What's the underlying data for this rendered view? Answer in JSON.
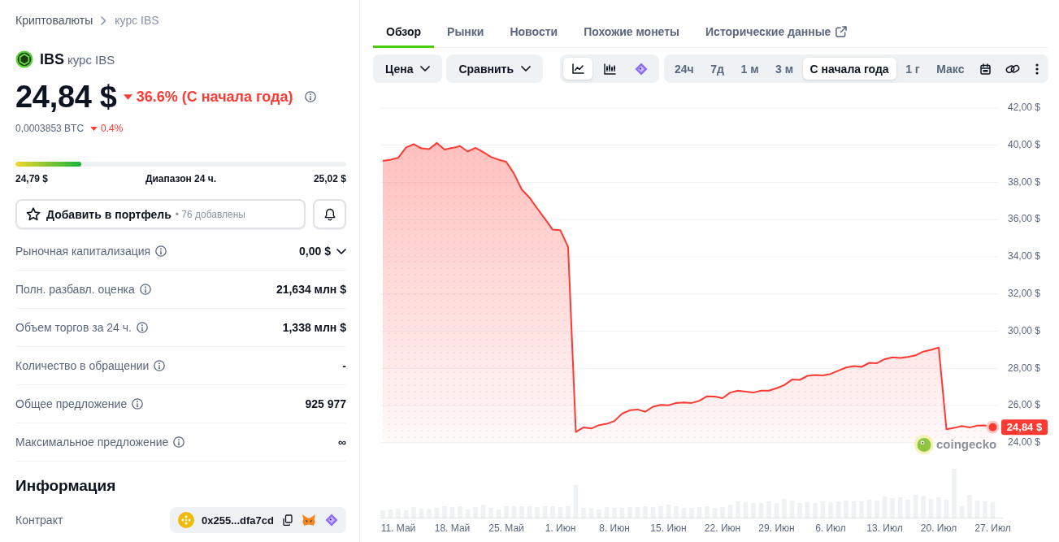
{
  "breadcrumb": [
    {
      "label": "Криптовалюты",
      "current": false
    },
    {
      "label": "курс IBS",
      "current": true
    }
  ],
  "coin": {
    "symbol": "IBS",
    "name": "курс IBS",
    "price": "24,84 $",
    "change": {
      "down": true,
      "text": "36.6% (С начала года)"
    },
    "btc_price": "0,0003853 BTC",
    "btc_change": {
      "down": true,
      "text": "0.4%"
    }
  },
  "range_24h": {
    "level": 0.2,
    "low": "24,79 $",
    "label": "Диапазон 24 ч.",
    "high": "25,02 $"
  },
  "portfolio_button": {
    "label": "Добавить в портфель",
    "count": "• 76 добавлены"
  },
  "stats": [
    {
      "label": "Рыночная капитализация",
      "value": "0,00 $",
      "expandable": true
    },
    {
      "label": "Полн. разбавл. оценка",
      "value": "21,634 млн $",
      "expandable": false
    },
    {
      "label": "Объем торгов за 24 ч.",
      "value": "1,338 млн $",
      "expandable": false
    },
    {
      "label": "Количество в обращении",
      "value": "-",
      "expandable": false
    },
    {
      "label": "Общее предложение",
      "value": "925 977",
      "expandable": false
    },
    {
      "label": "Максимальное предложение",
      "value": "∞",
      "expandable": false
    }
  ],
  "info": {
    "title": "Информация",
    "rows": [
      {
        "label": "Контракт",
        "address": "0x255...dfa7cd"
      }
    ]
  },
  "tabs": [
    {
      "label": "Обзор",
      "selected": true,
      "external": false
    },
    {
      "label": "Рынки",
      "selected": false,
      "external": false
    },
    {
      "label": "Новости",
      "selected": false,
      "external": false
    },
    {
      "label": "Похожие монеты",
      "selected": false,
      "external": false
    },
    {
      "label": "Исторические данные",
      "selected": false,
      "external": true
    }
  ],
  "toolbar": {
    "dropdowns": [
      {
        "label": "Цена"
      },
      {
        "label": "Сравнить"
      }
    ],
    "chart_types": [
      {
        "kind": "line",
        "selected": true
      },
      {
        "kind": "candles",
        "selected": false
      },
      {
        "kind": "diamond",
        "selected": false
      }
    ],
    "ranges": [
      {
        "label": "24ч",
        "selected": false
      },
      {
        "label": "7д",
        "selected": false
      },
      {
        "label": "1 м",
        "selected": false
      },
      {
        "label": "3 м",
        "selected": false
      },
      {
        "label": "С начала года",
        "selected": true
      },
      {
        "label": "1 г",
        "selected": false
      },
      {
        "label": "Макс",
        "selected": false
      }
    ],
    "tools": [
      {
        "kind": "calendar"
      },
      {
        "kind": "link"
      },
      {
        "kind": "more"
      }
    ]
  },
  "chart": {
    "brand": "coingecko",
    "chart_data": {
      "type": "area",
      "grid": true,
      "categories": [
        null,
        null,
        "11. Май",
        null,
        null,
        null,
        null,
        null,
        null,
        "18. Май",
        null,
        null,
        null,
        null,
        null,
        null,
        "25. Май",
        null,
        null,
        null,
        null,
        null,
        null,
        "1. Июн",
        null,
        null,
        null,
        null,
        null,
        null,
        "8. Июн",
        null,
        null,
        null,
        null,
        null,
        null,
        "15. Июн",
        null,
        null,
        null,
        null,
        null,
        null,
        "22. Июн",
        null,
        null,
        null,
        null,
        null,
        null,
        "29. Июн",
        null,
        null,
        null,
        null,
        null,
        null,
        "6. Июл",
        null,
        null,
        null,
        null,
        null,
        null,
        "13. Июл",
        null,
        null,
        null,
        null,
        null,
        null,
        "20. Июл",
        null,
        null,
        null,
        null,
        null,
        null,
        "27. Июл"
      ],
      "values": [
        39.15,
        39.22,
        39.32,
        39.87,
        40.06,
        39.83,
        39.79,
        40.12,
        39.77,
        39.85,
        39.95,
        39.66,
        39.86,
        39.63,
        39.37,
        39.22,
        39.1,
        38.46,
        37.62,
        37.18,
        36.6,
        36.04,
        35.46,
        35.43,
        34.53,
        24.58,
        24.83,
        24.77,
        24.95,
        25.02,
        25.17,
        25.57,
        25.75,
        25.79,
        25.67,
        25.94,
        26.04,
        26.02,
        26.14,
        26.17,
        26.14,
        26.26,
        26.5,
        26.49,
        26.4,
        26.7,
        26.8,
        26.75,
        26.7,
        26.8,
        26.8,
        26.93,
        27.1,
        27.4,
        27.38,
        27.6,
        27.65,
        27.62,
        27.7,
        27.88,
        28.05,
        28.12,
        28.08,
        28.3,
        28.28,
        28.5,
        28.59,
        28.56,
        28.62,
        28.7,
        28.9,
        29.0,
        29.12,
        24.73,
        24.8,
        24.9,
        24.82,
        24.92,
        24.93,
        24.84
      ],
      "ylim": [
        24,
        42
      ],
      "yticks": [
        {
          "value": 42,
          "label": "42,00 $"
        },
        {
          "value": 40,
          "label": "40,00 $"
        },
        {
          "value": 38,
          "label": "38,00 $"
        },
        {
          "value": 36,
          "label": "36,00 $"
        },
        {
          "value": 34,
          "label": "34,00 $"
        },
        {
          "value": 32,
          "label": "32,00 $"
        },
        {
          "value": 30,
          "label": "30,00 $"
        },
        {
          "value": 28,
          "label": "28,00 $"
        },
        {
          "value": 26,
          "label": "26,00 $"
        },
        {
          "value": 24,
          "label": "24,00 $"
        }
      ],
      "annotations": [
        "24,84 $"
      ]
    }
  }
}
